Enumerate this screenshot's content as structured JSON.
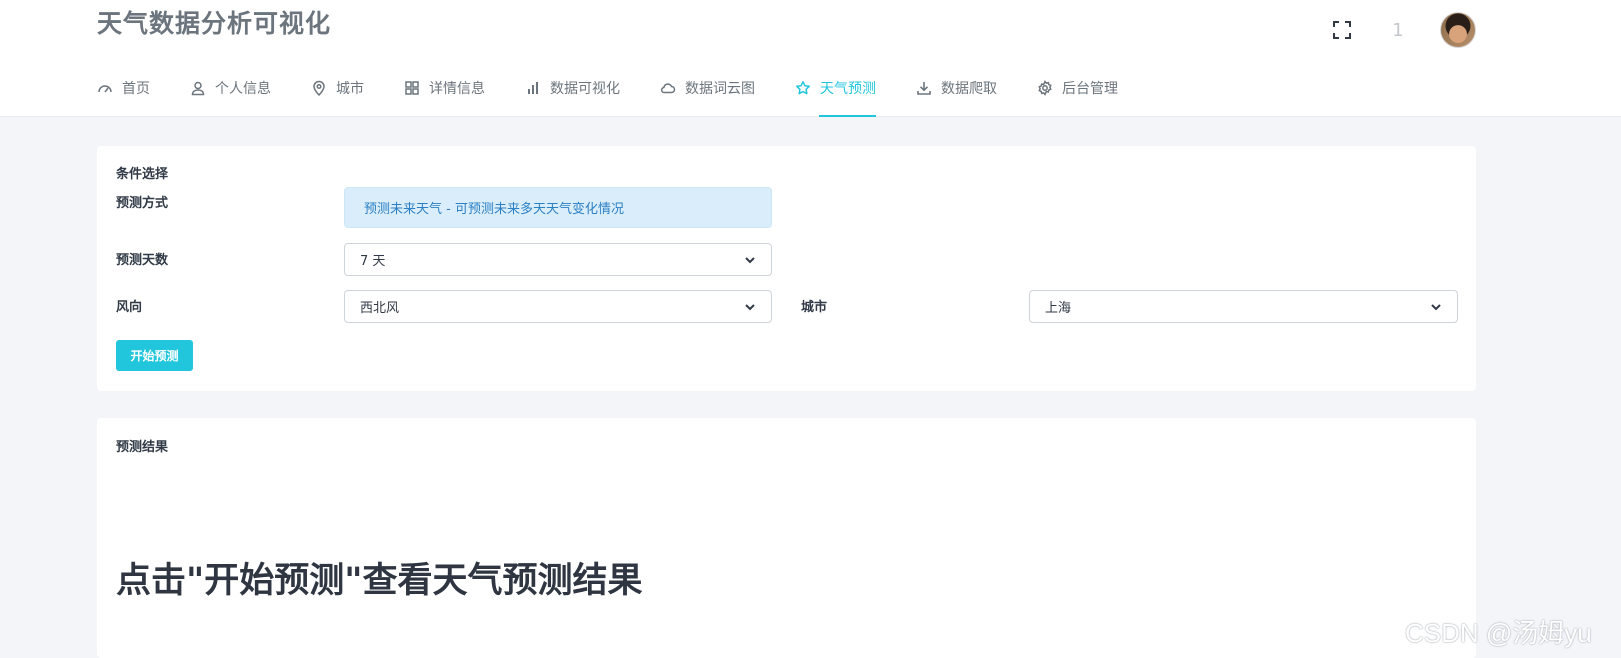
{
  "app": {
    "title": "天气数据分析可视化"
  },
  "header": {
    "notification_count": "1"
  },
  "nav": [
    {
      "label": "首页",
      "icon": "dashboard-icon"
    },
    {
      "label": "个人信息",
      "icon": "user-icon"
    },
    {
      "label": "城市",
      "icon": "map-pin-icon"
    },
    {
      "label": "详情信息",
      "icon": "grid-icon"
    },
    {
      "label": "数据可视化",
      "icon": "bar-chart-icon"
    },
    {
      "label": "数据词云图",
      "icon": "cloud-icon"
    },
    {
      "label": "天气预测",
      "icon": "star-icon",
      "active": true
    },
    {
      "label": "数据爬取",
      "icon": "download-icon"
    },
    {
      "label": "后台管理",
      "icon": "gear-icon"
    }
  ],
  "conditions": {
    "heading": "条件选择",
    "method_label": "预测方式",
    "method_value": "预测未来天气 - 可预测未来多天天气变化情况",
    "days_label": "预测天数",
    "days_value": "7 天",
    "wind_label": "风向",
    "wind_value": "西北风",
    "city_label": "城市",
    "city_value": "上海",
    "start_button": "开始预测"
  },
  "result": {
    "heading": "预测结果",
    "hint": "点击\"开始预测\"查看天气预测结果"
  },
  "watermark": "CSDN @汤姆yu",
  "colors": {
    "accent": "#22c6dc",
    "alert_bg": "#d9eefa",
    "alert_text": "#2c7fc3",
    "page_bg": "#f3f5f9"
  }
}
